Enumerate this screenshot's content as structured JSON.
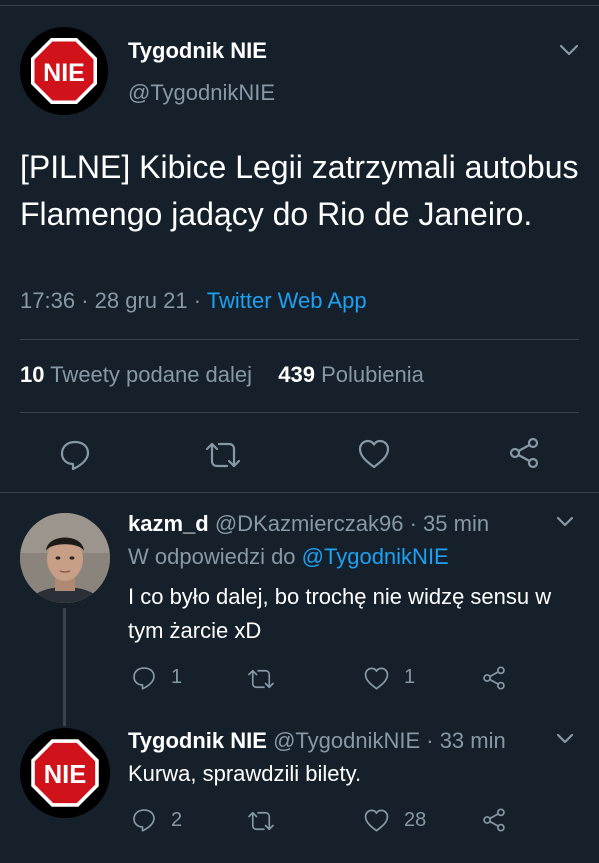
{
  "main_tweet": {
    "avatar_text": "NIE",
    "name": "Tygodnik NIE",
    "handle": "@TygodnikNIE",
    "text": "[PILNE] Kibice Legii zatrzymali autobus Flamengo jadący do Rio de Janeiro.",
    "time": "17:36",
    "date": "28 gru 21",
    "sep": "·",
    "source": "Twitter Web App",
    "retweets_count": "10",
    "retweets_label": "Tweety podane dalej",
    "likes_count": "439",
    "likes_label": "Polubienia"
  },
  "replies": [
    {
      "name": "kazm_d",
      "handle": "@DKazmierczak96",
      "time": "· 35 min",
      "reply_prefix": "W odpowiedzi do",
      "reply_to": "@TygodnikNIE",
      "text": "I co było dalej, bo trochę nie widzę sensu w tym żarcie xD",
      "reply_count": "1",
      "retweet_count": "",
      "like_count": "1"
    },
    {
      "name": "Tygodnik NIE",
      "handle": "@TygodnikNIE",
      "time": "· 33 min",
      "avatar_text": "NIE",
      "text": "Kurwa, sprawdzili bilety.",
      "reply_count": "2",
      "retweet_count": "",
      "like_count": "28"
    }
  ],
  "icons": [
    "chevron-down-icon",
    "reply-icon",
    "retweet-icon",
    "like-icon",
    "share-icon"
  ],
  "colors": {
    "background": "#15202b",
    "text": "#ffffff",
    "muted": "#8899a6",
    "link": "#1da1f2",
    "divider": "#38444d",
    "stop_sign_red": "#d0121b"
  }
}
